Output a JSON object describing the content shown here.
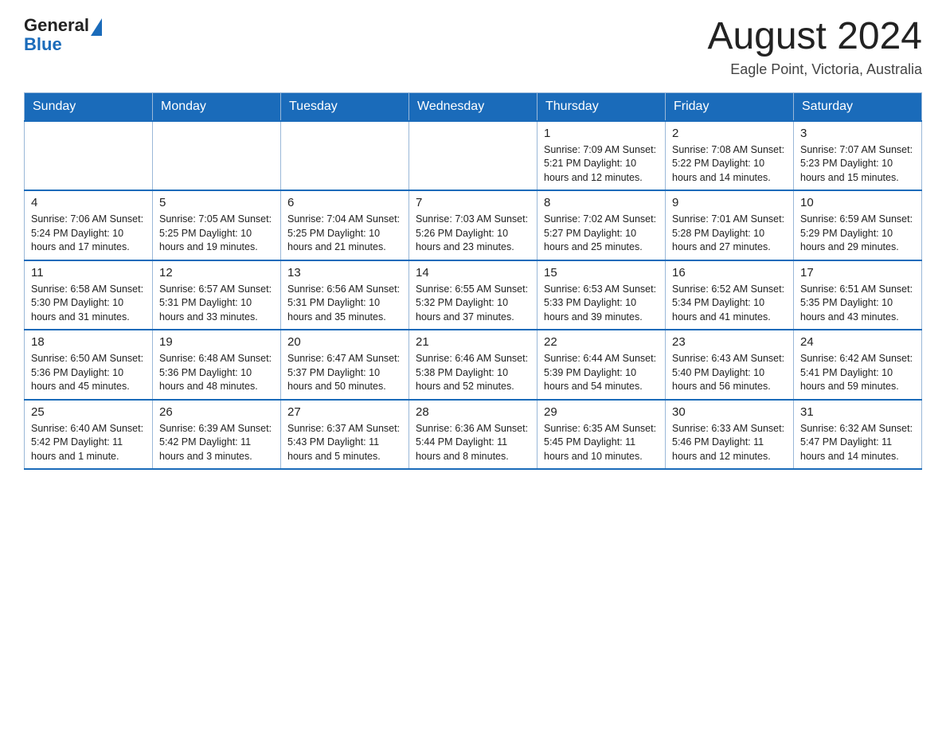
{
  "logo": {
    "text_general": "General",
    "text_blue": "Blue",
    "aria": "GeneralBlue logo"
  },
  "title": "August 2024",
  "subtitle": "Eagle Point, Victoria, Australia",
  "days_of_week": [
    "Sunday",
    "Monday",
    "Tuesday",
    "Wednesday",
    "Thursday",
    "Friday",
    "Saturday"
  ],
  "weeks": [
    [
      {
        "day": "",
        "info": ""
      },
      {
        "day": "",
        "info": ""
      },
      {
        "day": "",
        "info": ""
      },
      {
        "day": "",
        "info": ""
      },
      {
        "day": "1",
        "info": "Sunrise: 7:09 AM\nSunset: 5:21 PM\nDaylight: 10 hours and 12 minutes."
      },
      {
        "day": "2",
        "info": "Sunrise: 7:08 AM\nSunset: 5:22 PM\nDaylight: 10 hours and 14 minutes."
      },
      {
        "day": "3",
        "info": "Sunrise: 7:07 AM\nSunset: 5:23 PM\nDaylight: 10 hours and 15 minutes."
      }
    ],
    [
      {
        "day": "4",
        "info": "Sunrise: 7:06 AM\nSunset: 5:24 PM\nDaylight: 10 hours and 17 minutes."
      },
      {
        "day": "5",
        "info": "Sunrise: 7:05 AM\nSunset: 5:25 PM\nDaylight: 10 hours and 19 minutes."
      },
      {
        "day": "6",
        "info": "Sunrise: 7:04 AM\nSunset: 5:25 PM\nDaylight: 10 hours and 21 minutes."
      },
      {
        "day": "7",
        "info": "Sunrise: 7:03 AM\nSunset: 5:26 PM\nDaylight: 10 hours and 23 minutes."
      },
      {
        "day": "8",
        "info": "Sunrise: 7:02 AM\nSunset: 5:27 PM\nDaylight: 10 hours and 25 minutes."
      },
      {
        "day": "9",
        "info": "Sunrise: 7:01 AM\nSunset: 5:28 PM\nDaylight: 10 hours and 27 minutes."
      },
      {
        "day": "10",
        "info": "Sunrise: 6:59 AM\nSunset: 5:29 PM\nDaylight: 10 hours and 29 minutes."
      }
    ],
    [
      {
        "day": "11",
        "info": "Sunrise: 6:58 AM\nSunset: 5:30 PM\nDaylight: 10 hours and 31 minutes."
      },
      {
        "day": "12",
        "info": "Sunrise: 6:57 AM\nSunset: 5:31 PM\nDaylight: 10 hours and 33 minutes."
      },
      {
        "day": "13",
        "info": "Sunrise: 6:56 AM\nSunset: 5:31 PM\nDaylight: 10 hours and 35 minutes."
      },
      {
        "day": "14",
        "info": "Sunrise: 6:55 AM\nSunset: 5:32 PM\nDaylight: 10 hours and 37 minutes."
      },
      {
        "day": "15",
        "info": "Sunrise: 6:53 AM\nSunset: 5:33 PM\nDaylight: 10 hours and 39 minutes."
      },
      {
        "day": "16",
        "info": "Sunrise: 6:52 AM\nSunset: 5:34 PM\nDaylight: 10 hours and 41 minutes."
      },
      {
        "day": "17",
        "info": "Sunrise: 6:51 AM\nSunset: 5:35 PM\nDaylight: 10 hours and 43 minutes."
      }
    ],
    [
      {
        "day": "18",
        "info": "Sunrise: 6:50 AM\nSunset: 5:36 PM\nDaylight: 10 hours and 45 minutes."
      },
      {
        "day": "19",
        "info": "Sunrise: 6:48 AM\nSunset: 5:36 PM\nDaylight: 10 hours and 48 minutes."
      },
      {
        "day": "20",
        "info": "Sunrise: 6:47 AM\nSunset: 5:37 PM\nDaylight: 10 hours and 50 minutes."
      },
      {
        "day": "21",
        "info": "Sunrise: 6:46 AM\nSunset: 5:38 PM\nDaylight: 10 hours and 52 minutes."
      },
      {
        "day": "22",
        "info": "Sunrise: 6:44 AM\nSunset: 5:39 PM\nDaylight: 10 hours and 54 minutes."
      },
      {
        "day": "23",
        "info": "Sunrise: 6:43 AM\nSunset: 5:40 PM\nDaylight: 10 hours and 56 minutes."
      },
      {
        "day": "24",
        "info": "Sunrise: 6:42 AM\nSunset: 5:41 PM\nDaylight: 10 hours and 59 minutes."
      }
    ],
    [
      {
        "day": "25",
        "info": "Sunrise: 6:40 AM\nSunset: 5:42 PM\nDaylight: 11 hours and 1 minute."
      },
      {
        "day": "26",
        "info": "Sunrise: 6:39 AM\nSunset: 5:42 PM\nDaylight: 11 hours and 3 minutes."
      },
      {
        "day": "27",
        "info": "Sunrise: 6:37 AM\nSunset: 5:43 PM\nDaylight: 11 hours and 5 minutes."
      },
      {
        "day": "28",
        "info": "Sunrise: 6:36 AM\nSunset: 5:44 PM\nDaylight: 11 hours and 8 minutes."
      },
      {
        "day": "29",
        "info": "Sunrise: 6:35 AM\nSunset: 5:45 PM\nDaylight: 11 hours and 10 minutes."
      },
      {
        "day": "30",
        "info": "Sunrise: 6:33 AM\nSunset: 5:46 PM\nDaylight: 11 hours and 12 minutes."
      },
      {
        "day": "31",
        "info": "Sunrise: 6:32 AM\nSunset: 5:47 PM\nDaylight: 11 hours and 14 minutes."
      }
    ]
  ]
}
